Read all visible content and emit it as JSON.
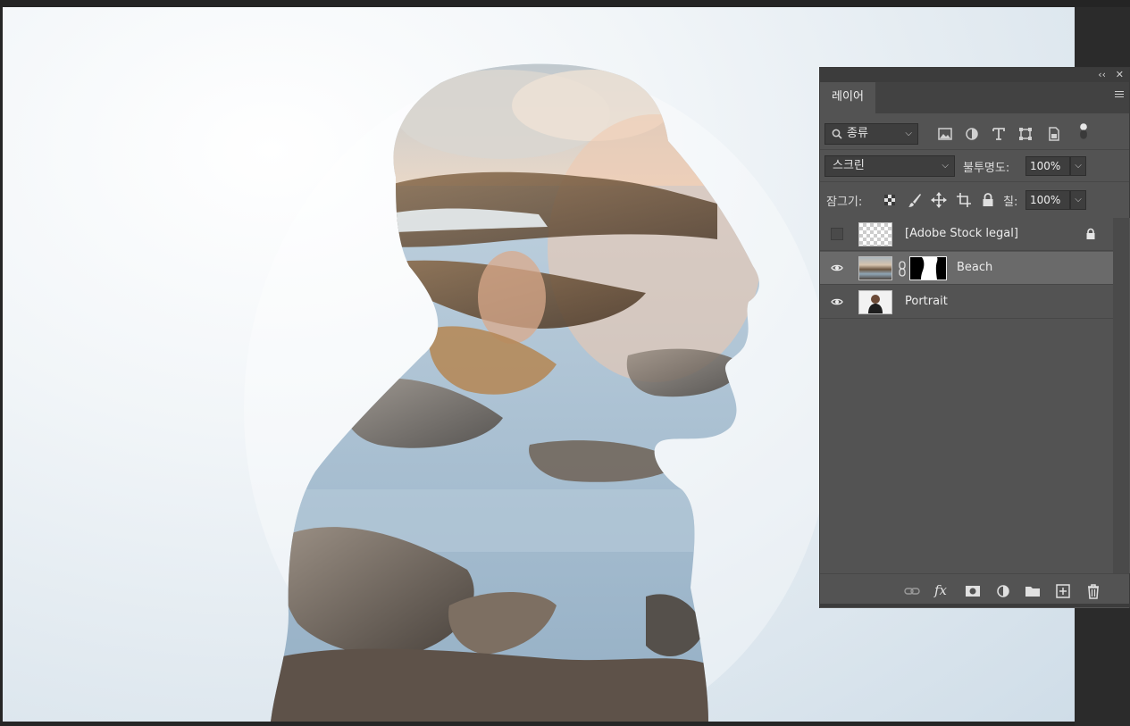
{
  "panel": {
    "collapse_label": "‹‹",
    "close_label": "✕",
    "tab_label": "레이어",
    "filter": {
      "value": "종류",
      "icons": [
        "image-filter-icon",
        "adjustment-filter-icon",
        "type-filter-icon",
        "shape-filter-icon",
        "smart-object-filter-icon",
        "filter-toggle-icon"
      ]
    },
    "blend_mode": "스크린",
    "opacity_label": "불투명도:",
    "opacity_value": "100%",
    "lock_label": "잠그기:",
    "fill_label": "칠:",
    "fill_value": "100%",
    "layers": [
      {
        "name": "[Adobe Stock legal]",
        "visible": false,
        "locked": true,
        "selected": false
      },
      {
        "name": "Beach",
        "visible": true,
        "locked": false,
        "selected": true,
        "has_mask": true
      },
      {
        "name": "Portrait",
        "visible": true,
        "locked": false,
        "selected": false
      }
    ],
    "footer_icons": [
      "link-icon",
      "fx-icon",
      "mask-icon",
      "adjustment-icon",
      "group-folder-icon",
      "new-layer-icon",
      "trash-icon"
    ],
    "fx_label": "fx"
  },
  "colors": {
    "panel_bg": "#535353",
    "selected_row": "#6a6a6a",
    "app_bg": "#262626"
  }
}
